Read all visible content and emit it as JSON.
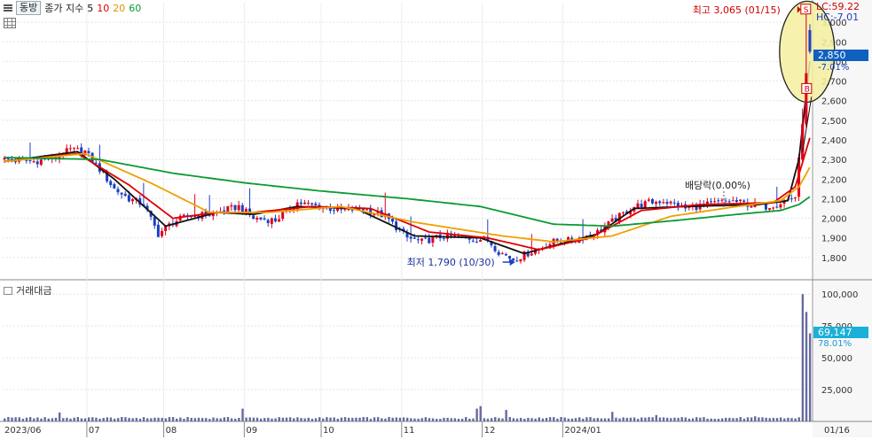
{
  "toolbar": {
    "stock_button": "동방",
    "indicator_title": "종가 지수",
    "ma_periods": [
      "5",
      "10",
      "20",
      "60"
    ]
  },
  "volume_title": "거래대금",
  "colors": {
    "up": "#e0001a",
    "down": "#1b3fc4",
    "ma5": "#111111",
    "ma10": "#e00000",
    "ma20": "#f0a000",
    "ma60": "#0a9a32",
    "volume": "#666aa0",
    "price_box": "#1060c0",
    "volume_box": "#1ab0d8"
  },
  "header_right": {
    "lc": "LC:59.22",
    "hc": "HC:-7.01"
  },
  "price_box": {
    "price": "2,850",
    "change": "-7.01%"
  },
  "volume_box": {
    "value": "69,147",
    "ratio": "78.01%"
  },
  "annotations": {
    "high": "최고 3,065 (01/15)",
    "low": "최저 1,790 (10/30)",
    "dividend": "배당락(0.00%)",
    "sell_marker": "S",
    "buy_marker": "B"
  },
  "chart_data": [
    {
      "type": "candlestick",
      "x_ticks": [
        "2023/06",
        "07",
        "08",
        "09",
        "10",
        "11",
        "12",
        "2024/01",
        "01/16"
      ],
      "price_axis": {
        "min": 1700,
        "max": 3100,
        "ticks": [
          "1,800",
          "1,900",
          "2,000",
          "2,100",
          "2,200",
          "2,300",
          "2,400",
          "2,500",
          "2,600",
          "2,700",
          "2,800",
          "2,900",
          "3,000"
        ]
      },
      "price_keypoints": [
        [
          0,
          2300
        ],
        [
          8,
          2290
        ],
        [
          14,
          2310
        ],
        [
          18,
          2350
        ],
        [
          22,
          2340
        ],
        [
          26,
          2250
        ],
        [
          30,
          2150
        ],
        [
          34,
          2100
        ],
        [
          38,
          2070
        ],
        [
          42,
          1920
        ],
        [
          46,
          1980
        ],
        [
          50,
          2010
        ],
        [
          56,
          2020
        ],
        [
          60,
          2040
        ],
        [
          64,
          2060
        ],
        [
          68,
          2000
        ],
        [
          74,
          1990
        ],
        [
          80,
          2080
        ],
        [
          86,
          2060
        ],
        [
          92,
          2040
        ],
        [
          98,
          2050
        ],
        [
          104,
          2010
        ],
        [
          110,
          1900
        ],
        [
          114,
          1880
        ],
        [
          120,
          1910
        ],
        [
          126,
          1900
        ],
        [
          132,
          1890
        ],
        [
          135,
          1830
        ],
        [
          139,
          1790
        ],
        [
          144,
          1830
        ],
        [
          150,
          1880
        ],
        [
          156,
          1890
        ],
        [
          162,
          1930
        ],
        [
          168,
          2010
        ],
        [
          172,
          2060
        ],
        [
          176,
          2080
        ],
        [
          180,
          2090
        ],
        [
          186,
          2050
        ],
        [
          192,
          2070
        ],
        [
          198,
          2090
        ],
        [
          204,
          2070
        ],
        [
          208,
          2060
        ],
        [
          212,
          2080
        ],
        [
          216,
          2110
        ],
        [
          218,
          2480
        ],
        [
          219,
          2720
        ],
        [
          220,
          2850
        ]
      ],
      "moving_averages": [
        {
          "period": "5",
          "points": [
            [
              0,
              2290
            ],
            [
              20,
              2340
            ],
            [
              30,
              2200
            ],
            [
              44,
              1960
            ],
            [
              58,
              2030
            ],
            [
              68,
              2020
            ],
            [
              80,
              2060
            ],
            [
              96,
              2050
            ],
            [
              112,
              1910
            ],
            [
              130,
              1900
            ],
            [
              142,
              1820
            ],
            [
              150,
              1860
            ],
            [
              162,
              1920
            ],
            [
              172,
              2050
            ],
            [
              186,
              2060
            ],
            [
              206,
              2070
            ],
            [
              214,
              2090
            ],
            [
              217,
              2300
            ],
            [
              220,
              2800
            ]
          ]
        },
        {
          "period": "10",
          "points": [
            [
              0,
              2290
            ],
            [
              20,
              2330
            ],
            [
              34,
              2170
            ],
            [
              46,
              2000
            ],
            [
              58,
              2030
            ],
            [
              68,
              2030
            ],
            [
              84,
              2060
            ],
            [
              100,
              2050
            ],
            [
              116,
              1930
            ],
            [
              132,
              1900
            ],
            [
              146,
              1840
            ],
            [
              160,
              1900
            ],
            [
              174,
              2040
            ],
            [
              190,
              2070
            ],
            [
              210,
              2080
            ],
            [
              216,
              2160
            ],
            [
              220,
              2410
            ]
          ]
        },
        {
          "period": "20",
          "points": [
            [
              0,
              2290
            ],
            [
              22,
              2330
            ],
            [
              40,
              2180
            ],
            [
              56,
              2030
            ],
            [
              72,
              2030
            ],
            [
              92,
              2060
            ],
            [
              112,
              1980
            ],
            [
              136,
              1910
            ],
            [
              150,
              1880
            ],
            [
              166,
              1910
            ],
            [
              182,
              2010
            ],
            [
              200,
              2060
            ],
            [
              212,
              2090
            ],
            [
              217,
              2160
            ],
            [
              220,
              2260
            ]
          ]
        },
        {
          "period": "60",
          "points": [
            [
              0,
              2310
            ],
            [
              26,
              2300
            ],
            [
              46,
              2230
            ],
            [
              66,
              2180
            ],
            [
              86,
              2140
            ],
            [
              110,
              2100
            ],
            [
              130,
              2060
            ],
            [
              150,
              1970
            ],
            [
              166,
              1960
            ],
            [
              184,
              1990
            ],
            [
              200,
              2020
            ],
            [
              212,
              2040
            ],
            [
              217,
              2070
            ],
            [
              220,
              2110
            ]
          ]
        }
      ],
      "highlight": {
        "high_value": 3065,
        "high_date": "01/15",
        "low_value": 1790,
        "low_date": "10/30"
      }
    },
    {
      "type": "bar",
      "title": "거래대금",
      "y_axis": {
        "min": 0,
        "max": 105000,
        "ticks": [
          "25,000",
          "50,000",
          "75,000",
          "100,000"
        ]
      },
      "spikes": [
        [
          15,
          7000
        ],
        [
          65,
          10000
        ],
        [
          129,
          10000
        ],
        [
          130,
          12000
        ],
        [
          137,
          9000
        ],
        [
          166,
          7500
        ],
        [
          178,
          5000
        ],
        [
          205,
          4000
        ],
        [
          218,
          100000
        ],
        [
          219,
          86000
        ],
        [
          220,
          69147
        ]
      ],
      "baseline": 2000
    }
  ]
}
